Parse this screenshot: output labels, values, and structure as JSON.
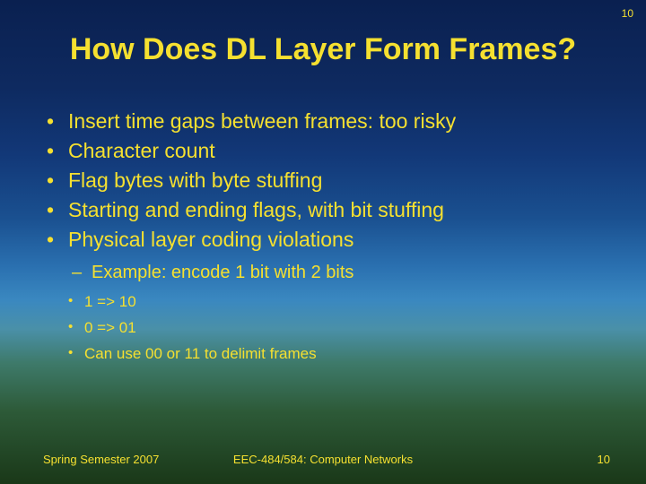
{
  "slide_number_top": "10",
  "title": "How Does DL Layer Form Frames?",
  "bullets": [
    "Insert time gaps between frames: too risky",
    "Character count",
    "Flag bytes with byte stuffing",
    "Starting and ending flags, with bit stuffing",
    "Physical layer coding violations"
  ],
  "sub1": "Example: encode 1 bit with 2 bits",
  "sub2": [
    "1 => 10",
    "0 => 01",
    "Can use 00 or 11 to delimit frames"
  ],
  "footer": {
    "left": "Spring Semester 2007",
    "center": "EEC-484/584: Computer Networks",
    "right": "10"
  }
}
